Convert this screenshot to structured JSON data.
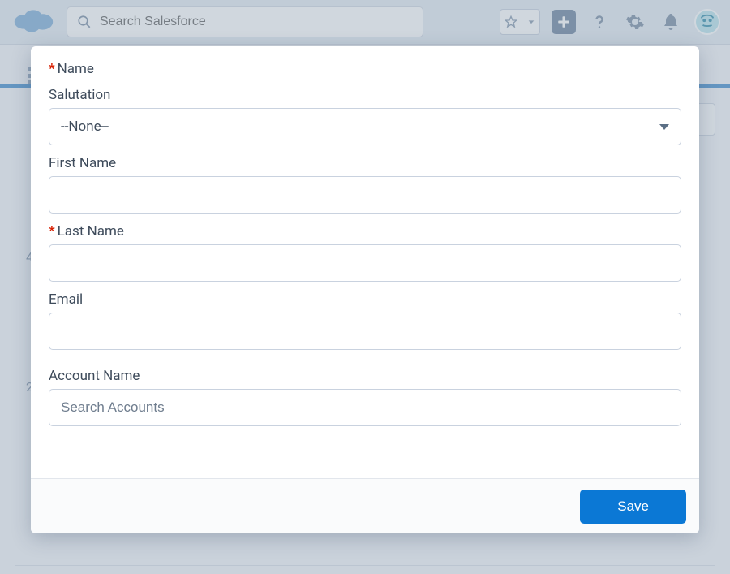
{
  "header": {
    "search_placeholder": "Search Salesforce"
  },
  "form": {
    "name_section_label": "Name",
    "salutation_label": "Salutation",
    "salutation_value": "--None--",
    "first_name_label": "First Name",
    "first_name_value": "",
    "last_name_label": "Last Name",
    "last_name_value": "",
    "email_label": "Email",
    "email_value": "",
    "account_name_label": "Account Name",
    "account_name_placeholder": "Search Accounts"
  },
  "footer": {
    "save_label": "Save"
  },
  "bg": {
    "num1": "4",
    "num2": "2"
  }
}
